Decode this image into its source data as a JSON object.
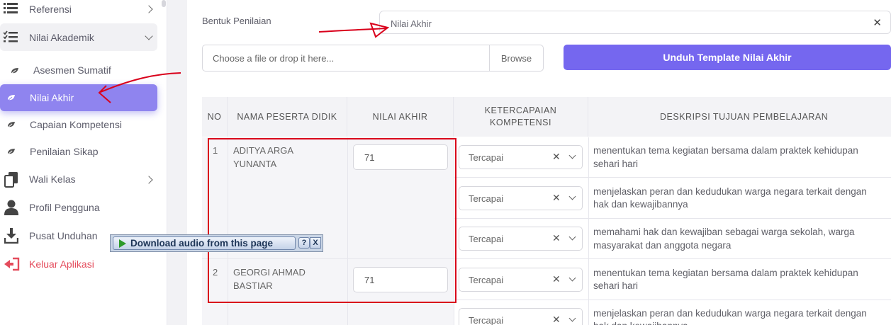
{
  "sidebar": {
    "items": [
      {
        "label": "Referensi"
      },
      {
        "label": "Nilai Akademik"
      },
      {
        "label": "Asesmen Sumatif"
      },
      {
        "label": "Nilai Akhir"
      },
      {
        "label": "Capaian Kompetensi"
      },
      {
        "label": "Penilaian Sikap"
      },
      {
        "label": "Wali Kelas"
      },
      {
        "label": "Profil Pengguna"
      },
      {
        "label": "Pusat Unduhan"
      },
      {
        "label": "Keluar Aplikasi"
      }
    ]
  },
  "form": {
    "bentuk_label": "Bentuk Penilaian",
    "bentuk_value": "Nilai Akhir",
    "file_placeholder": "Choose a file or drop it here...",
    "browse_label": "Browse",
    "download_template_label": "Unduh Template Nilai Akhir"
  },
  "table": {
    "headers": [
      "NO",
      "NAMA PESERTA DIDIK",
      "NILAI AKHIR",
      "KETERCAPAIAN KOMPETENSI",
      "DESKRIPSI TUJUAN PEMBELAJARAN"
    ],
    "students": [
      {
        "no": "1",
        "name": "ADITYA ARGA YUNANTA",
        "nilai": "71",
        "rows": [
          {
            "ketercapaian": "Tercapai",
            "deskripsi_line1": "menentukan tema kegiatan bersama dalam praktek kehidupan",
            "deskripsi_line2": "sehari hari"
          },
          {
            "ketercapaian": "Tercapai",
            "deskripsi_line1": "menjelaskan peran dan kedudukan warga negara terkait dengan",
            "deskripsi_line2": "hak dan kewajibannya"
          },
          {
            "ketercapaian": "Tercapai",
            "deskripsi_line1": "memahami hak dan kewajiban sebagai warga sekolah, warga",
            "deskripsi_line2": "masyarakat dan anggota negara"
          }
        ]
      },
      {
        "no": "2",
        "name": "GEORGI AHMAD BASTIAR",
        "nilai": "71",
        "rows": [
          {
            "ketercapaian": "Tercapai",
            "deskripsi_line1": "menentukan tema kegiatan bersama dalam praktek kehidupan",
            "deskripsi_line2": "sehari hari"
          },
          {
            "ketercapaian": "Tercapai",
            "deskripsi_line1": "menjelaskan peran dan kedudukan warga negara terkait dengan",
            "deskripsi_line2": "hak dan kewajibannya"
          }
        ]
      }
    ]
  },
  "popup": {
    "download_label": "Download audio from this page",
    "help_label": "?",
    "close_label": "X"
  },
  "colors": {
    "accent": "#7567ef",
    "active_item": "#8f84ef",
    "annotation_red": "#d9001b",
    "logout": "#e44c5c"
  },
  "icons": [
    "list-icon",
    "checklist-icon",
    "leaf-icon",
    "copy-icon",
    "user-icon",
    "download-icon",
    "logout-icon",
    "close-icon",
    "chevron-down-icon",
    "chevron-right-icon",
    "play-icon"
  ]
}
